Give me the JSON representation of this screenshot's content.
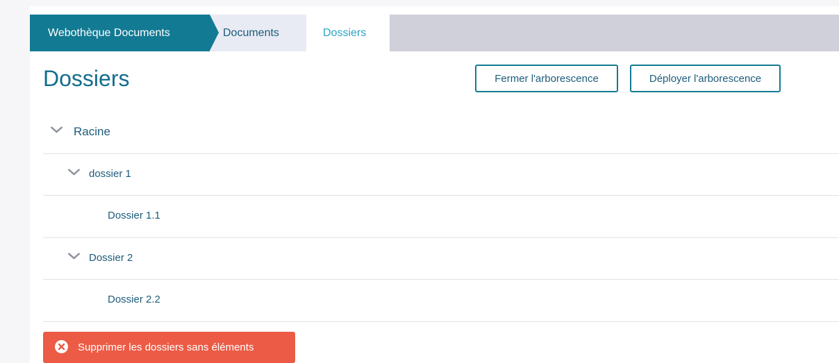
{
  "breadcrumb": {
    "home": "Webothèque Documents",
    "documents": "Documents",
    "current": "Dossiers"
  },
  "page": {
    "title": "Dossiers"
  },
  "actions": {
    "collapse_label": "Fermer l'arborescence",
    "expand_label": "Déployer l'arborescence",
    "delete_empty_label": "Supprimer les dossiers sans éléments"
  },
  "tree": {
    "items": [
      {
        "label": "Racine",
        "level": 0,
        "expanded": true
      },
      {
        "label": "dossier 1",
        "level": 1,
        "expanded": true
      },
      {
        "label": "Dossier 1.1",
        "level": 2
      },
      {
        "label": "Dossier 2",
        "level": 1,
        "expanded": true
      },
      {
        "label": "Dossier 2.2",
        "level": 2
      }
    ]
  },
  "colors": {
    "primary": "#137a93",
    "title": "#136d8d",
    "link": "#1d5c7a",
    "active_tab": "#2aa3c5",
    "danger": "#ec5b45"
  }
}
